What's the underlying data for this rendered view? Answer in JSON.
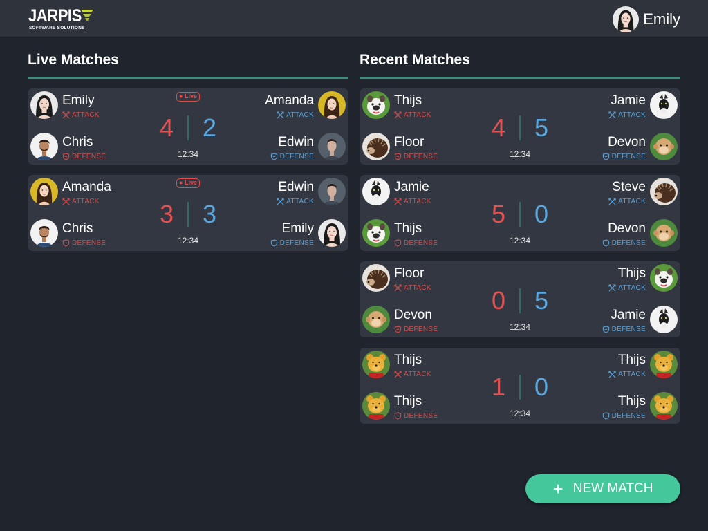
{
  "app": {
    "logo_word": "JARPIS",
    "logo_subtitle": "SOFTWARE SOLUTIONS",
    "user_name": "Emily"
  },
  "sections": {
    "live_title": "Live Matches",
    "recent_title": "Recent Matches"
  },
  "labels": {
    "attack": "ATTACK",
    "defense": "DEFENSE",
    "live": "Live"
  },
  "live_matches": [
    {
      "live": true,
      "left_attack": "Emily",
      "left_attack_avatar": "emily",
      "left_defense": "Chris",
      "left_defense_avatar": "chris",
      "right_attack": "Amanda",
      "right_attack_avatar": "amanda",
      "right_defense": "Edwin",
      "right_defense_avatar": "edwin",
      "score_red": "4",
      "score_blue": "2",
      "time": "12:34"
    },
    {
      "live": true,
      "left_attack": "Amanda",
      "left_attack_avatar": "amanda",
      "left_defense": "Chris",
      "left_defense_avatar": "chris",
      "right_attack": "Edwin",
      "right_attack_avatar": "edwin",
      "right_defense": "Emily",
      "right_defense_avatar": "emily",
      "score_red": "3",
      "score_blue": "3",
      "time": "12:34"
    }
  ],
  "recent_matches": [
    {
      "left_attack": "Thijs",
      "left_attack_avatar": "bulldog",
      "left_defense": "Floor",
      "left_defense_avatar": "hedgehog",
      "right_attack": "Jamie",
      "right_attack_avatar": "goat",
      "right_defense": "Devon",
      "right_defense_avatar": "monkey",
      "score_red": "4",
      "score_blue": "5",
      "time": "12:34"
    },
    {
      "left_attack": "Jamie",
      "left_attack_avatar": "goat",
      "left_defense": "Thijs",
      "left_defense_avatar": "bulldog",
      "right_attack": "Steve",
      "right_attack_avatar": "hedgehog",
      "right_defense": "Devon",
      "right_defense_avatar": "monkey",
      "score_red": "5",
      "score_blue": "0",
      "time": "12:34"
    },
    {
      "left_attack": "Floor",
      "left_attack_avatar": "hedgehog",
      "left_defense": "Devon",
      "left_defense_avatar": "monkey",
      "right_attack": "Thijs",
      "right_attack_avatar": "bulldog",
      "right_defense": "Jamie",
      "right_defense_avatar": "goat",
      "score_red": "0",
      "score_blue": "5",
      "time": "12:34"
    },
    {
      "left_attack": "Thijs",
      "left_attack_avatar": "pooh",
      "left_defense": "Thijs",
      "left_defense_avatar": "pooh",
      "right_attack": "Thijs",
      "right_attack_avatar": "pooh",
      "right_defense": "Thijs",
      "right_defense_avatar": "pooh",
      "score_red": "1",
      "score_blue": "0",
      "time": "12:34"
    }
  ],
  "fab": {
    "label": "NEW MATCH"
  },
  "colors": {
    "accent": "#45c79c",
    "red_team": "#e35253",
    "blue_team": "#5aa6de",
    "card": "#323741",
    "background": "#1f242d"
  }
}
